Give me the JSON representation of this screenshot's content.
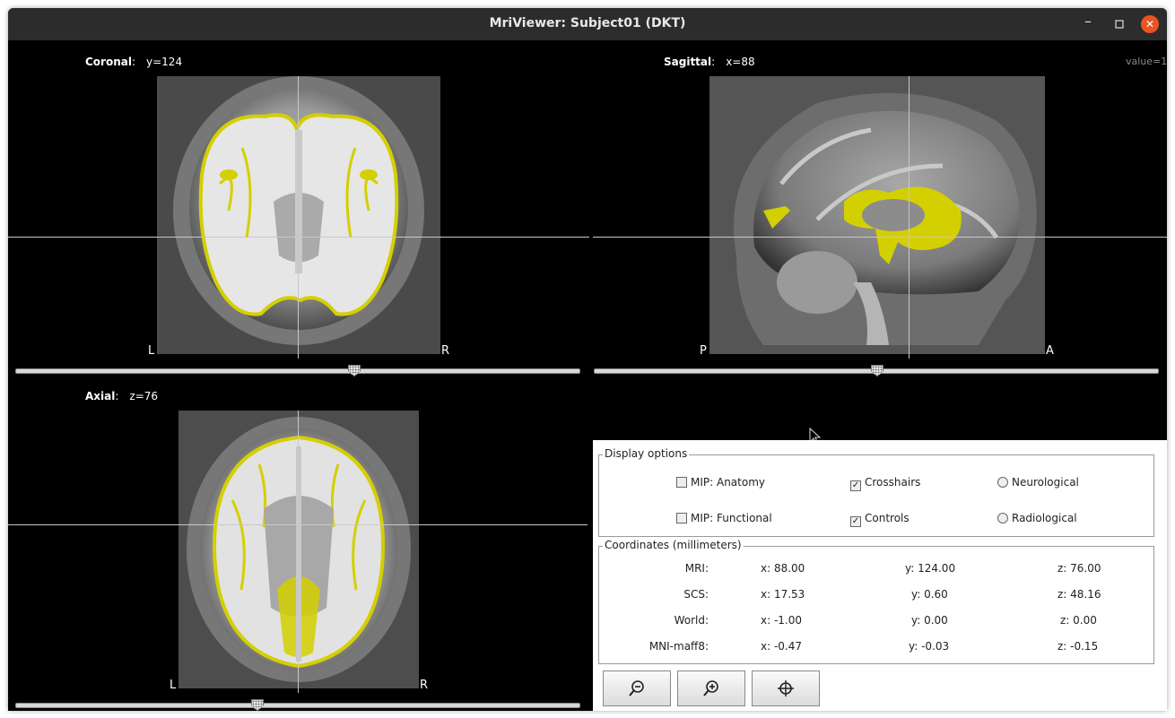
{
  "window": {
    "title": "MriViewer: Subject01 (DKT)"
  },
  "views": {
    "coronal": {
      "name": "Coronal",
      "coord": "y=124",
      "left": "L",
      "right": "R",
      "slider_pos": 0.6
    },
    "sagittal": {
      "name": "Sagittal",
      "coord": "x=88",
      "left": "P",
      "right": "A",
      "slider_pos": 0.5
    },
    "axial": {
      "name": "Axial",
      "coord": "z=76",
      "left": "L",
      "right": "R",
      "slider_pos": 0.427
    },
    "value_readout": "value=1"
  },
  "colors": {
    "overlay": "#d4cf00",
    "background": "#000000"
  },
  "display_options": {
    "title": "Display options",
    "mip_anatomy": {
      "label": "MIP: Anatomy",
      "checked": false
    },
    "mip_functional": {
      "label": "MIP: Functional",
      "checked": false
    },
    "crosshairs": {
      "label": "Crosshairs",
      "checked": true
    },
    "controls": {
      "label": "Controls",
      "checked": true
    },
    "neurological": {
      "label": "Neurological"
    },
    "radiological": {
      "label": "Radiological"
    }
  },
  "coordinates": {
    "title": "Coordinates (millimeters)",
    "rows": [
      {
        "label": "MRI:",
        "x": "x: 88.00",
        "y": "y: 124.00",
        "z": "z: 76.00"
      },
      {
        "label": "SCS:",
        "x": "x: 17.53",
        "y": "y: 0.60",
        "z": "z: 48.16"
      },
      {
        "label": "World:",
        "x": "x: -1.00",
        "y": "y: 0.00",
        "z": "z: 0.00"
      },
      {
        "label": "MNI-maff8:",
        "x": "x: -0.47",
        "y": "y: -0.03",
        "z": "z: -0.15"
      }
    ]
  },
  "toolbar": {
    "icons": [
      "zoom-out-icon",
      "zoom-in-icon",
      "crosshair-target-icon"
    ]
  }
}
